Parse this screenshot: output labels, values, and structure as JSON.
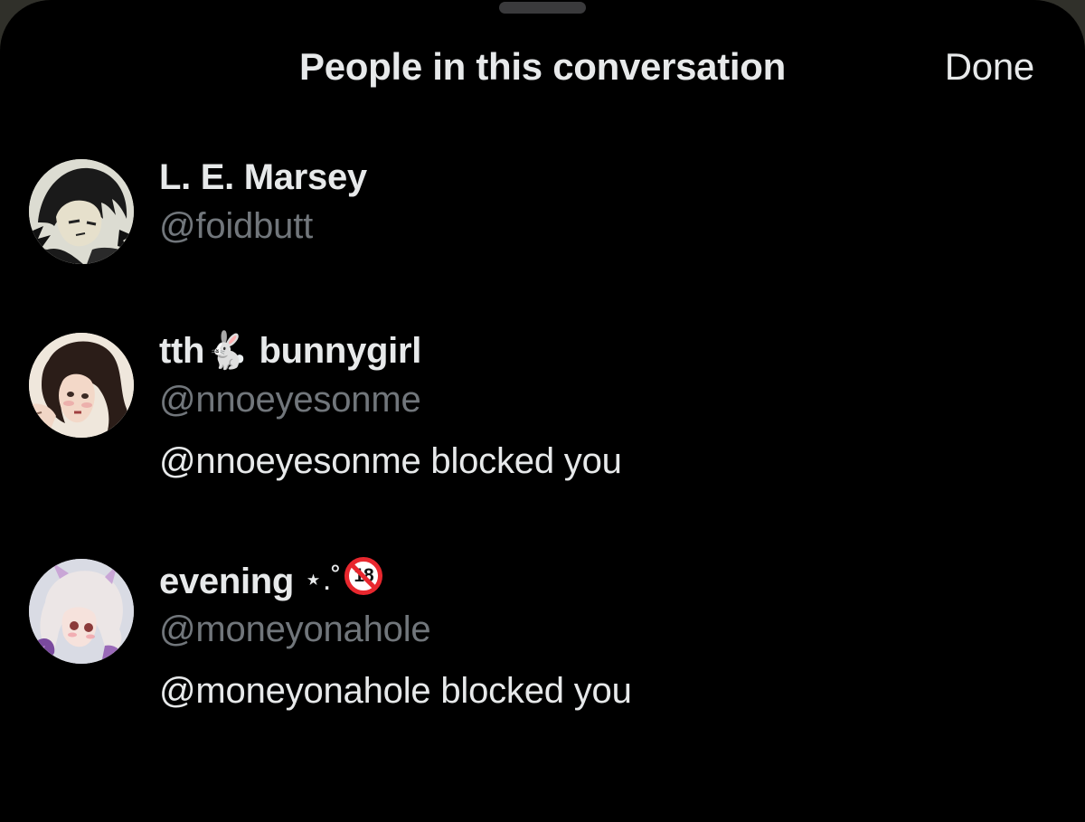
{
  "header": {
    "title": "People in this conversation",
    "done_label": "Done"
  },
  "participants": [
    {
      "name": "L. E. Marsey",
      "handle": "@foidbutt",
      "status": ""
    },
    {
      "name_prefix": "tth",
      "name_emoji": "🐇",
      "name_suffix": "bunnygirl",
      "handle": "@nnoeyesonme",
      "status": "@nnoeyesonme blocked you"
    },
    {
      "name_prefix": "evening",
      "name_sparkle": "⋆.˚",
      "name_badge": "18",
      "handle": "@moneyonahole",
      "status": "@moneyonahole blocked you"
    }
  ],
  "colors": {
    "background": "#000000",
    "primary_text": "#e7e9ea",
    "secondary_text": "#71767b",
    "no18_red": "#e8272e"
  },
  "icons": {
    "no18": "no-under-18-icon",
    "rabbit": "rabbit-emoji"
  }
}
